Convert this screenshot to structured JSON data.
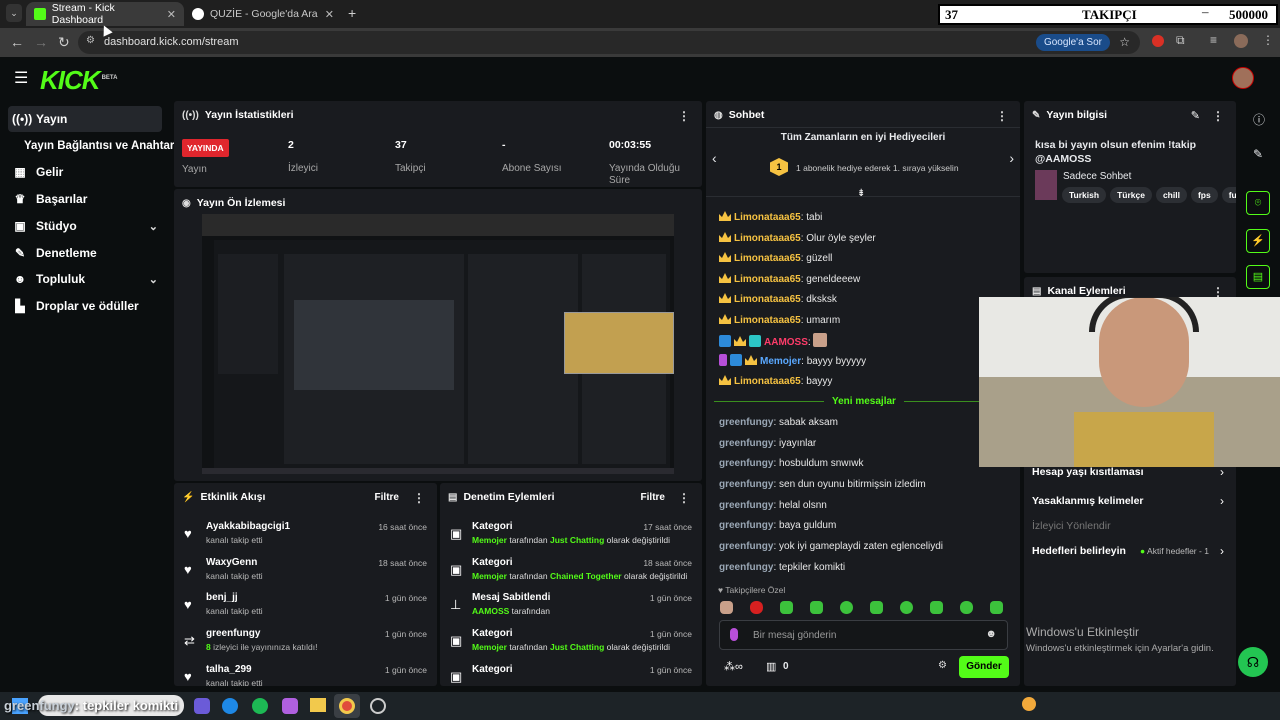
{
  "browser": {
    "tabs": [
      {
        "title": "Stream - Kick Dashboard"
      },
      {
        "title": "QUZİE - Google'da Ara"
      }
    ],
    "url": "dashboard.kick.com/stream",
    "google_sor_label": "Google'a Sor",
    "follower_overlay": {
      "current": "37",
      "label": "TAKIPÇI",
      "target": "500000"
    }
  },
  "sidebar": {
    "items": [
      {
        "label": "Yayın",
        "icon": "broadcast-icon"
      },
      {
        "label": "Yayın Bağlantısı ve Anahtarı",
        "icon": ""
      },
      {
        "label": "Gelir",
        "icon": "chart-icon"
      },
      {
        "label": "Başarılar",
        "icon": "trophy-icon"
      },
      {
        "label": "Stüdyo",
        "icon": "grid-icon"
      },
      {
        "label": "Denetleme",
        "icon": "wrench-icon"
      },
      {
        "label": "Topluluk",
        "icon": "people-icon"
      },
      {
        "label": "Droplar ve ödüller",
        "icon": "podium-icon"
      }
    ]
  },
  "stats": {
    "title": "Yayın İstatistikleri",
    "live_badge": "YAYINDA",
    "live_label": "Yayın",
    "viewers": {
      "value": "2",
      "label": "İzleyici"
    },
    "followers": {
      "value": "37",
      "label": "Takipçi"
    },
    "subs": {
      "value": "-",
      "label": "Abone Sayısı"
    },
    "uptime": {
      "value": "00:03:55",
      "label": "Yayında Olduğu Süre"
    }
  },
  "preview": {
    "title": "Yayın Ön İzlemesi"
  },
  "activity": {
    "title": "Etkinlik Akışı",
    "filter": "Filtre",
    "rows": [
      {
        "name": "Ayakkabibagcigi1",
        "sub": "kanalı takip etti",
        "time": "16 saat önce"
      },
      {
        "name": "WaxyGenn",
        "sub": "kanalı takip etti",
        "time": "18 saat önce"
      },
      {
        "name": "benj_jj",
        "sub": "kanalı takip etti",
        "time": "1 gün önce"
      },
      {
        "name": "greenfungy",
        "sub_green": "8",
        "sub": " izleyici ile yayınınıza katıldı!",
        "time": "1 gün önce"
      },
      {
        "name": "talha_299",
        "sub": "kanalı takip etti",
        "time": "1 gün önce"
      }
    ]
  },
  "moderation": {
    "title": "Denetim Eylemleri",
    "filter": "Filtre",
    "rows": [
      {
        "name": "Kategori",
        "who": "Memojer",
        "mid": " tarafından ",
        "what": "Just Chatting",
        "end": " olarak değiştirildi",
        "time": "17 saat önce"
      },
      {
        "name": "Kategori",
        "who": "Memojer",
        "mid": " tarafından ",
        "what": "Chained Together",
        "end": " olarak değiştirildi",
        "time": "18 saat önce"
      },
      {
        "name": "Mesaj Sabitlendi",
        "who": "AAMOSS",
        "mid": " tarafından",
        "what": "",
        "end": "",
        "time": "1 gün önce"
      },
      {
        "name": "Kategori",
        "who": "Memojer",
        "mid": " tarafından ",
        "what": "Just Chatting",
        "end": " olarak değiştirildi",
        "time": "1 gün önce"
      },
      {
        "name": "Kategori",
        "who": "",
        "mid": "",
        "what": "",
        "end": "",
        "time": "1 gün önce"
      }
    ]
  },
  "chat": {
    "title": "Sohbet",
    "gifters_title": "Tüm Zamanların en iyi Hediyecileri",
    "gifters_rank": "1",
    "gifters_text": "1 abonelik hediye ederek 1. sıraya yükselin",
    "messages": [
      {
        "user": "Limonataaa65",
        "text": "tabi"
      },
      {
        "user": "Limonataaa65",
        "text": "Olur öyle şeyler"
      },
      {
        "user": "Limonataaa65",
        "text": "güzell"
      },
      {
        "user": "Limonataaa65",
        "text": "geneldeeew"
      },
      {
        "user": "Limonataaa65",
        "text": "dksksk"
      },
      {
        "user": "Limonataaa65",
        "text": "umarım"
      },
      {
        "user": "AAMOSS",
        "text": ""
      },
      {
        "user": "Memojer",
        "text": "bayyy byyyyy"
      },
      {
        "user": "Limonataaa65",
        "text": "bayyy"
      }
    ],
    "new_messages_label": "Yeni mesajlar",
    "new_messages": [
      {
        "user": "greenfungy",
        "text": "sabak aksam"
      },
      {
        "user": "greenfungy",
        "text": "iyayınlar"
      },
      {
        "user": "greenfungy",
        "text": "hosbuldum snwıwk"
      },
      {
        "user": "greenfungy",
        "text": "sen dun oyunu bitirmişsin izledim"
      },
      {
        "user": "greenfungy",
        "text": "helal olsnn"
      },
      {
        "user": "greenfungy",
        "text": "baya guldum"
      },
      {
        "user": "greenfungy",
        "text": "yok iyi gameplaydi zaten eglenceliydi"
      },
      {
        "user": "greenfungy",
        "text": "tepkiler komikti"
      }
    ],
    "followers_only": "Takipçilere Özel",
    "input_placeholder": "Bir mesaj gönderin",
    "points": "0",
    "send_label": "Gönder"
  },
  "stream_info": {
    "title": "Yayın bilgisi",
    "stream_title": "kısa bi yayın olsun efenim !takip @AAMOSS",
    "category": "Sadece Sohbet",
    "tags": [
      "Turkish",
      "Türkçe",
      "chill",
      "fps",
      "fu"
    ]
  },
  "channel_actions": {
    "title": "Kanal Eylemleri",
    "items": [
      {
        "label": "Hesap yaşı kısıtlaması"
      },
      {
        "label": "Yasaklanmış kelimeler"
      },
      {
        "label": "İzleyici Yönlendir"
      },
      {
        "label": "Hedefleri belirleyin",
        "status": "Aktif hedefler - 1"
      }
    ],
    "windows_title": "Windows'u Etkinleştir",
    "windows_sub": "Windows'u etkinleştirmek için Ayarlar'a gidin."
  },
  "overlay_chat": {
    "user": "greenfungy",
    "text": "tepkiler komikti"
  },
  "colors": {
    "brand": "#53fc18",
    "live": "#e0262d",
    "gold": "#f5c242",
    "panel": "#191b1f"
  }
}
